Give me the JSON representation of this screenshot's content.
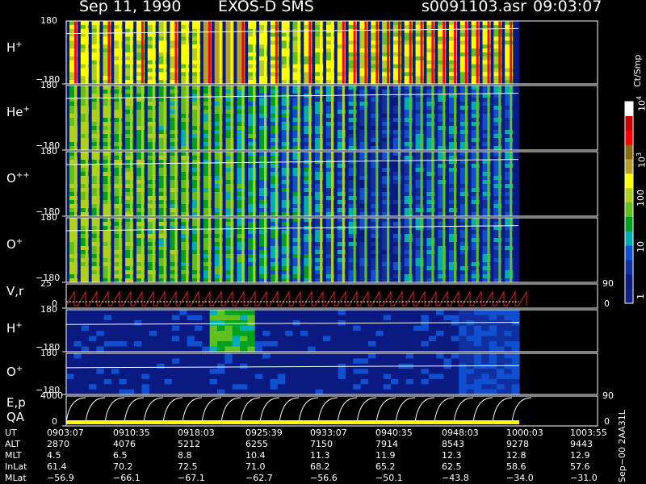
{
  "header": {
    "date": "Sep 11, 1990",
    "mission": "EXOS-D SMS",
    "file": "s0091103.asr",
    "time": "09:03:07"
  },
  "panels": [
    {
      "id": "h1",
      "label": "H",
      "sup": "+",
      "top_tick": "180",
      "bottom_tick": "−180"
    },
    {
      "id": "he1",
      "label": "He",
      "sup": "+",
      "top_tick": "180",
      "bottom_tick": "−180"
    },
    {
      "id": "opp",
      "label": "O",
      "sup": "++",
      "top_tick": "180",
      "bottom_tick": "−180"
    },
    {
      "id": "o1",
      "label": "O",
      "sup": "+",
      "top_tick": "180",
      "bottom_tick": "−180"
    },
    {
      "id": "vr",
      "label": "V,r",
      "sup": "",
      "top_tick": "25",
      "bottom_tick": "0",
      "right_top": "90",
      "right_bottom": "0"
    },
    {
      "id": "h2",
      "label": "H",
      "sup": "+",
      "top_tick": "180",
      "bottom_tick": "−180"
    },
    {
      "id": "o2",
      "label": "O",
      "sup": "+",
      "top_tick": "180",
      "bottom_tick": "−180"
    },
    {
      "id": "ep",
      "label": "E,p",
      "label2": "QA",
      "sup": "",
      "top_tick": "4000",
      "bottom_tick": "0",
      "right_top": "90",
      "right_bottom": "0"
    }
  ],
  "colorbar": {
    "unit": "Ct/Smp",
    "ticks": [
      {
        "base": "10",
        "exp": "4",
        "pos": 0.0
      },
      {
        "base": "10",
        "exp": "3",
        "pos": 0.28
      },
      {
        "base": "100",
        "exp": "",
        "pos": 0.47
      },
      {
        "base": "10",
        "exp": "",
        "pos": 0.7
      },
      {
        "base": "1",
        "exp": "",
        "pos": 0.93
      }
    ],
    "colors": [
      "#ffffff",
      "#c80000",
      "#ff0000",
      "#8a6a14",
      "#b8a030",
      "#ffff00",
      "#b0d020",
      "#60c020",
      "#00a020",
      "#00b0b0",
      "#1050d0",
      "#1030a0",
      "#0a1a80",
      "#102080"
    ]
  },
  "table": {
    "row_labels": [
      "UT",
      "ALT",
      "MLT",
      "InLat",
      "MLat"
    ],
    "columns": [
      [
        "0903:07",
        "2870",
        "4.5",
        "61.4",
        "−56.9"
      ],
      [
        "0910:35",
        "4076",
        "6.5",
        "70.2",
        "−66.1"
      ],
      [
        "0918:03",
        "5212",
        "8.8",
        "72.5",
        "−67.1"
      ],
      [
        "0925:39",
        "6255",
        "10.4",
        "71.0",
        "−62.7"
      ],
      [
        "0933:07",
        "7150",
        "11.3",
        "68.2",
        "−56.6"
      ],
      [
        "0940:35",
        "7914",
        "11.9",
        "65.2",
        "−50.1"
      ],
      [
        "0948:03",
        "8543",
        "12.3",
        "62.5",
        "−43.8"
      ],
      [
        "1000:03",
        "9278",
        "12.8",
        "58.6",
        "−34.0"
      ],
      [
        "1003:55",
        "9443",
        "12.9",
        "57.6",
        "−31.0"
      ]
    ]
  },
  "side_note": "Sep−00 2AA31L",
  "chart_data": {
    "type": "heatmap",
    "title": "Sep 11, 1990    EXOS-D SMS",
    "x_time_ticks": [
      "0903:07",
      "0910:35",
      "0918:03",
      "0925:39",
      "0933:07",
      "0940:35",
      "0948:03",
      "1000:03",
      "1003:55"
    ],
    "panels": [
      "H+",
      "He+",
      "O++",
      "O+",
      "V,r",
      "H+",
      "O+",
      "E,p QA"
    ],
    "ylim_angle": [
      -180,
      180
    ],
    "colorbar_range": [
      1,
      10000
    ],
    "colorbar_scale": "log"
  }
}
